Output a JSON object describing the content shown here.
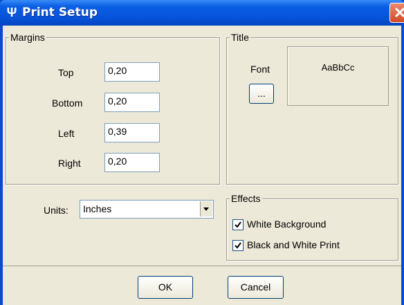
{
  "window": {
    "title": "Print Setup"
  },
  "margins": {
    "legend": "Margins",
    "top_label": "Top",
    "top_value": "0,20",
    "bottom_label": "Bottom",
    "bottom_value": "0,20",
    "left_label": "Left",
    "left_value": "0,39",
    "right_label": "Right",
    "right_value": "0,20"
  },
  "title_group": {
    "legend": "Title",
    "font_label": "Font",
    "font_button": "...",
    "preview_text": "AaBbCc"
  },
  "units": {
    "label": "Units:",
    "selected": "Inches"
  },
  "effects": {
    "legend": "Effects",
    "white_background": {
      "label": "White Background",
      "checked": true
    },
    "bw_print": {
      "label": "Black and White Print",
      "checked": true
    }
  },
  "buttons": {
    "ok": "OK",
    "cancel": "Cancel"
  }
}
